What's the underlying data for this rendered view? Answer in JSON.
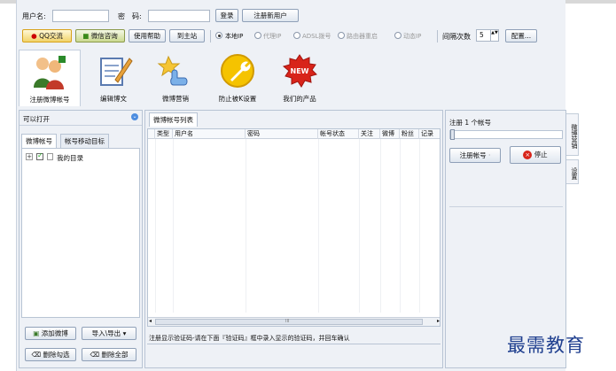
{
  "login": {
    "username_label": "用户名:",
    "password_label": "密　码:",
    "login_button": "登录",
    "register_button": "注册新用户"
  },
  "toolbar": {
    "qq_button": "QQ交流",
    "weixin_button": "微信咨询",
    "help_button": "使用帮助",
    "home_button": "到主站",
    "ip_options": [
      {
        "label": "本地IP",
        "selected": true
      },
      {
        "label": "代理IP",
        "selected": false
      },
      {
        "label": "ADSL拨号",
        "selected": false
      },
      {
        "label": "路由器重启",
        "selected": false
      },
      {
        "label": "动态IP",
        "selected": false
      }
    ],
    "interval_label": "间隔次数",
    "interval_value": "5",
    "config_button": "配置..."
  },
  "tools": [
    {
      "label": "注册微博帐号",
      "icon": "people-icon"
    },
    {
      "label": "编辑博文",
      "icon": "edit-document-icon"
    },
    {
      "label": "微博营销",
      "icon": "pointing-hand-icon"
    },
    {
      "label": "防止被K设置",
      "icon": "wrench-icon"
    },
    {
      "label": "我们的产品",
      "icon": "new-badge-icon"
    }
  ],
  "left": {
    "header": "可以打开",
    "tabs": [
      "微博帐号",
      "帐号移动目标"
    ],
    "tree_item": "我的目录",
    "buttons": {
      "add": "添加微博",
      "import_export": "导入\\导出",
      "delete_selected": "删除勾选",
      "delete_all": "删除全部"
    }
  },
  "middle": {
    "tab": "微博帐号列表",
    "columns": [
      "类型",
      "用户名",
      "密码",
      "帐号状态",
      "关注",
      "微博",
      "粉丝",
      "记录"
    ],
    "status_text": "注册显示验证码-请在下面『验证码』框中录入显示的验证码，并回车确认",
    "scroll_marker": "III"
  },
  "right": {
    "title": "注册 1 个帐号",
    "register_button": "注册帐号",
    "stop_button": "停止",
    "side_tabs": [
      "微博营销",
      "设置"
    ]
  },
  "watermark": "最需教育"
}
